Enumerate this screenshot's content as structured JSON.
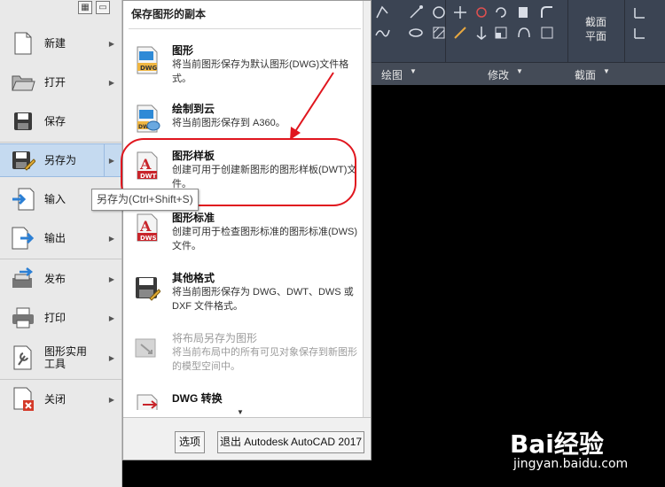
{
  "left_menu": {
    "items": [
      {
        "label": "新建",
        "has_submenu": true
      },
      {
        "label": "打开",
        "has_submenu": true
      },
      {
        "label": "保存",
        "has_submenu": false
      },
      {
        "label": "另存为",
        "has_submenu": true,
        "active": true
      },
      {
        "label": "输入",
        "has_submenu": false
      },
      {
        "label": "输出",
        "has_submenu": true
      },
      {
        "label": "发布",
        "has_submenu": true
      },
      {
        "label": "打印",
        "has_submenu": true
      },
      {
        "label": "图形实用工具",
        "has_submenu": true
      },
      {
        "label": "关闭",
        "has_submenu": true
      }
    ]
  },
  "tooltip": {
    "text": "另存为(Ctrl+Shift+S)"
  },
  "submenu": {
    "header": "保存图形的副本",
    "items": [
      {
        "title": "图形",
        "desc": "将当前图形保存为默认图形(DWG)文件格式。",
        "icon": "dwg-file-icon",
        "disabled": false
      },
      {
        "title": "绘制到云",
        "desc": "将当前图形保存到 A360。",
        "icon": "dwg-cloud-icon",
        "disabled": false
      },
      {
        "title": "图形样板",
        "desc": "创建可用于创建新图形的图形样板(DWT)文件。",
        "icon": "dwt-file-icon",
        "disabled": false
      },
      {
        "title": "图形标准",
        "desc": "创建可用于检查图形标准的图形标准(DWS)文件。",
        "icon": "dws-file-icon",
        "disabled": false
      },
      {
        "title": "其他格式",
        "desc": "将当前图形保存为 DWG、DWT、DWS 或 DXF 文件格式。",
        "icon": "save-other-icon",
        "disabled": false
      },
      {
        "title": "将布局另存为图形",
        "desc": "将当前布局中的所有可见对象保存到新图形的模型空间中。",
        "icon": "layout-save-icon",
        "disabled": true
      },
      {
        "title": "DWG 转换",
        "desc": "",
        "icon": "dwg-convert-icon",
        "disabled": false
      }
    ],
    "footer": {
      "options_label": "选项",
      "exit_label": "退出 Autodesk AutoCAD 2017"
    }
  },
  "ribbon": {
    "panels": [
      {
        "label": "绘图"
      },
      {
        "label": "修改"
      },
      {
        "label": "截面"
      }
    ],
    "section_button": {
      "line1": "截面",
      "line2": "平面"
    }
  },
  "watermark": {
    "logo": "Bai经验",
    "url": "jingyan.baidu.com"
  },
  "colors": {
    "accent_red": "#e0161e",
    "menu_bg": "#e9e9e9",
    "active_bg": "#c5daf0",
    "ribbon_bg": "#3b4453"
  }
}
